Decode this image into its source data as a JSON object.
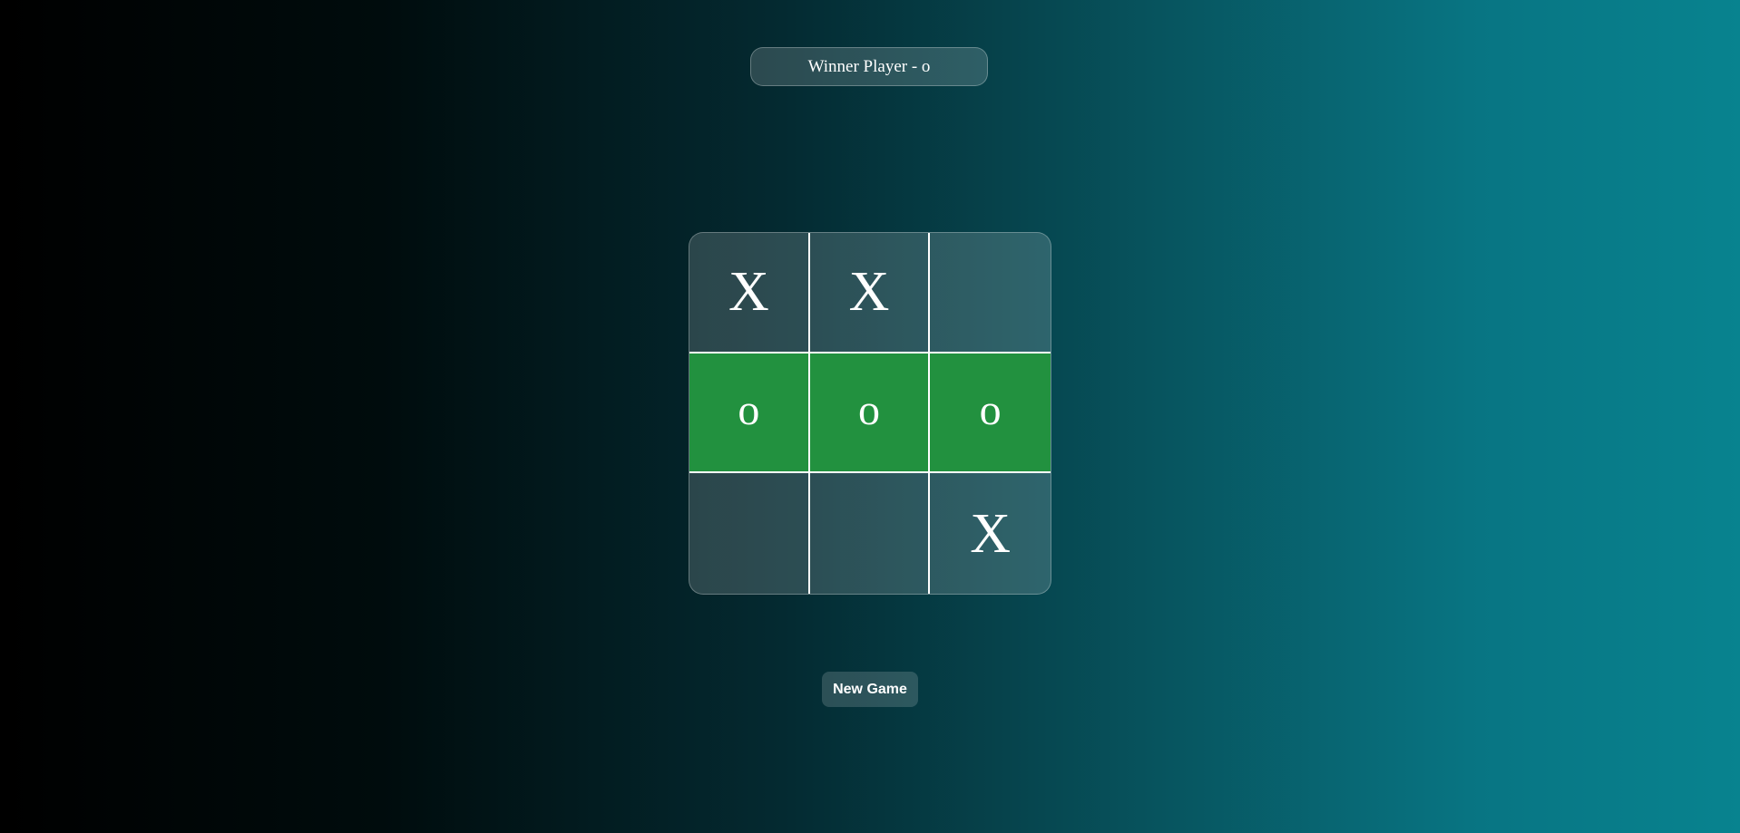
{
  "status": {
    "text": "Winner Player - o"
  },
  "board": {
    "cells": [
      "X",
      "X",
      "",
      "o",
      "o",
      "o",
      "",
      "",
      "X"
    ],
    "winning_cells": [
      3,
      4,
      5
    ],
    "win_color": "#22913f"
  },
  "controls": {
    "new_game_label": "New Game"
  }
}
